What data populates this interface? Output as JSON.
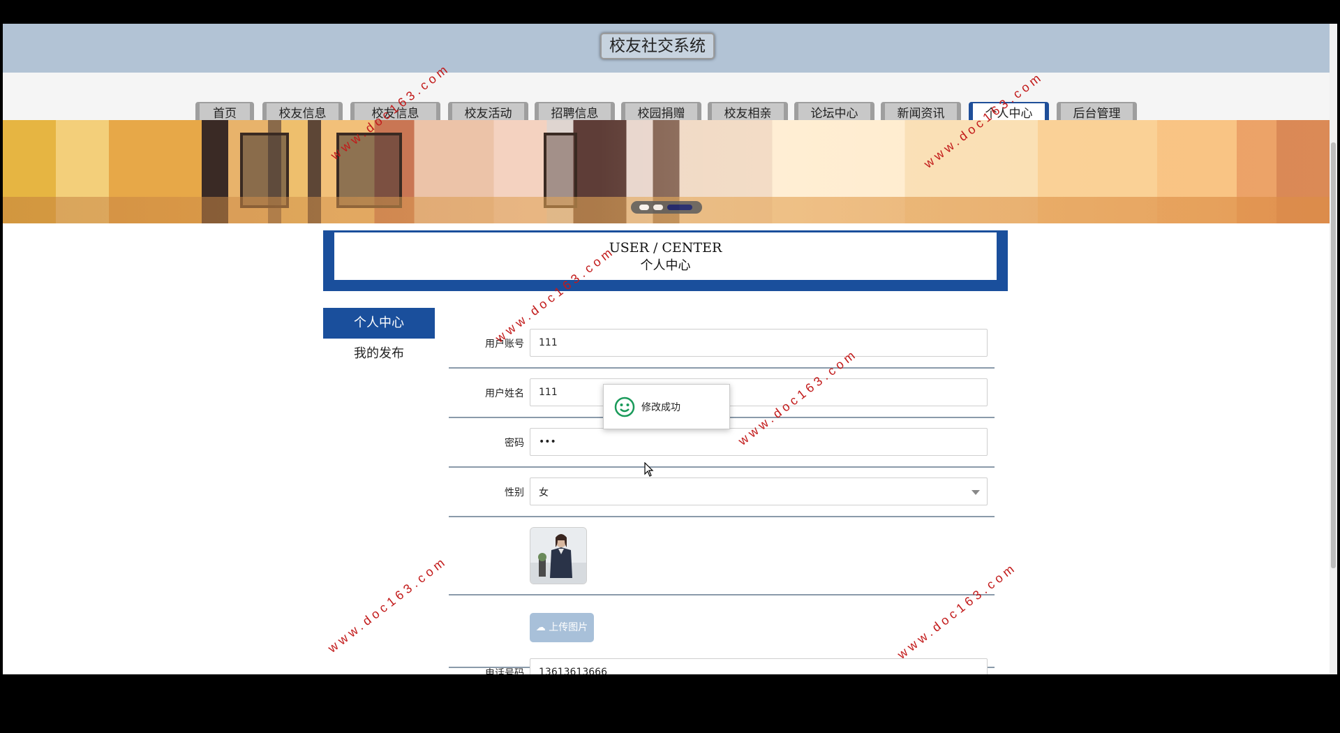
{
  "header": {
    "title": "校友社交系统"
  },
  "nav": {
    "items": [
      {
        "label": "首页"
      },
      {
        "label": "校友信息"
      },
      {
        "label": "校友信息"
      },
      {
        "label": "校友活动"
      },
      {
        "label": "招聘信息"
      },
      {
        "label": "校园捐赠"
      },
      {
        "label": "校友相亲"
      },
      {
        "label": "论坛中心"
      },
      {
        "label": "新闻资讯"
      },
      {
        "label": "个人中心"
      },
      {
        "label": "后台管理"
      }
    ],
    "active_index": 9
  },
  "banner": {
    "slide_count": 3,
    "active_slide": 3
  },
  "center": {
    "title_en": "USER / CENTER",
    "title_cn": "个人中心"
  },
  "sidebar": {
    "items": [
      {
        "label": "个人中心"
      },
      {
        "label": "我的发布"
      }
    ]
  },
  "form": {
    "account": {
      "label": "用户账号",
      "value": "111"
    },
    "name": {
      "label": "用户姓名",
      "value": "111"
    },
    "password": {
      "label": "密码",
      "value": "111"
    },
    "gender": {
      "label": "性别",
      "value": "女"
    },
    "upload_label": "上传图片",
    "phone": {
      "label": "电话号码",
      "value": "13613613666"
    }
  },
  "toast": {
    "message": "修改成功"
  },
  "watermark": {
    "text": "www.doc163.com"
  },
  "colors": {
    "brand": "#1a4f9c",
    "header_bg": "#b2c3d5",
    "watermark": "#c21a1a",
    "toast_icon": "#1a9a5a"
  }
}
